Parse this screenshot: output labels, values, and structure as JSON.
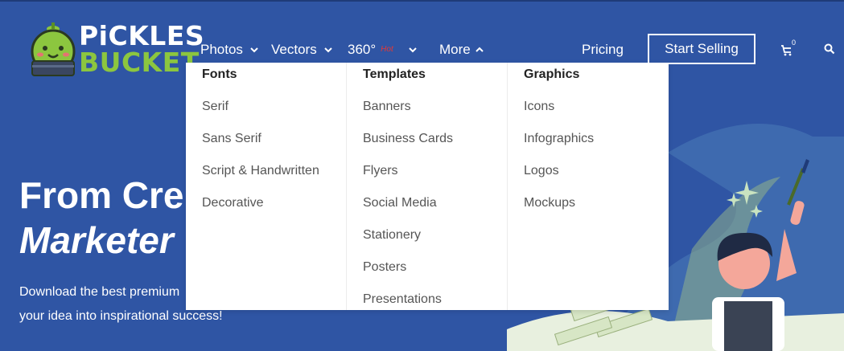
{
  "brand": {
    "line1": "PiCKLES",
    "line2": "BUCKET",
    "colors": {
      "primary_bg": "#2f55a4",
      "logo_green": "#8cc63f",
      "hot_red": "#e53935"
    }
  },
  "nav": {
    "photos": "Photos",
    "vectors": "Vectors",
    "threesixty": "360°",
    "hot_badge": "Hot",
    "more": "More",
    "pricing": "Pricing",
    "start_selling": "Start Selling",
    "cart_count": "0"
  },
  "dropdown": {
    "columns": [
      {
        "heading": "Fonts",
        "items": [
          "Serif",
          "Sans Serif",
          "Script & Handwritten",
          "Decorative"
        ]
      },
      {
        "heading": "Templates",
        "items": [
          "Banners",
          "Business Cards",
          "Flyers",
          "Social Media",
          "Stationery",
          "Posters",
          "Presentations"
        ]
      },
      {
        "heading": "Graphics",
        "items": [
          "Icons",
          "Infographics",
          "Logos",
          "Mockups"
        ]
      }
    ]
  },
  "hero": {
    "title_line1": "From Cre",
    "title_line2": "Marketer",
    "para_line1": "Download the best premium",
    "para_line2": "your idea into inspirational success!"
  },
  "icons": {
    "cart": "cart-icon",
    "search": "search-icon",
    "chevron_down": "chevron-down-icon",
    "chevron_up": "chevron-up-icon"
  }
}
